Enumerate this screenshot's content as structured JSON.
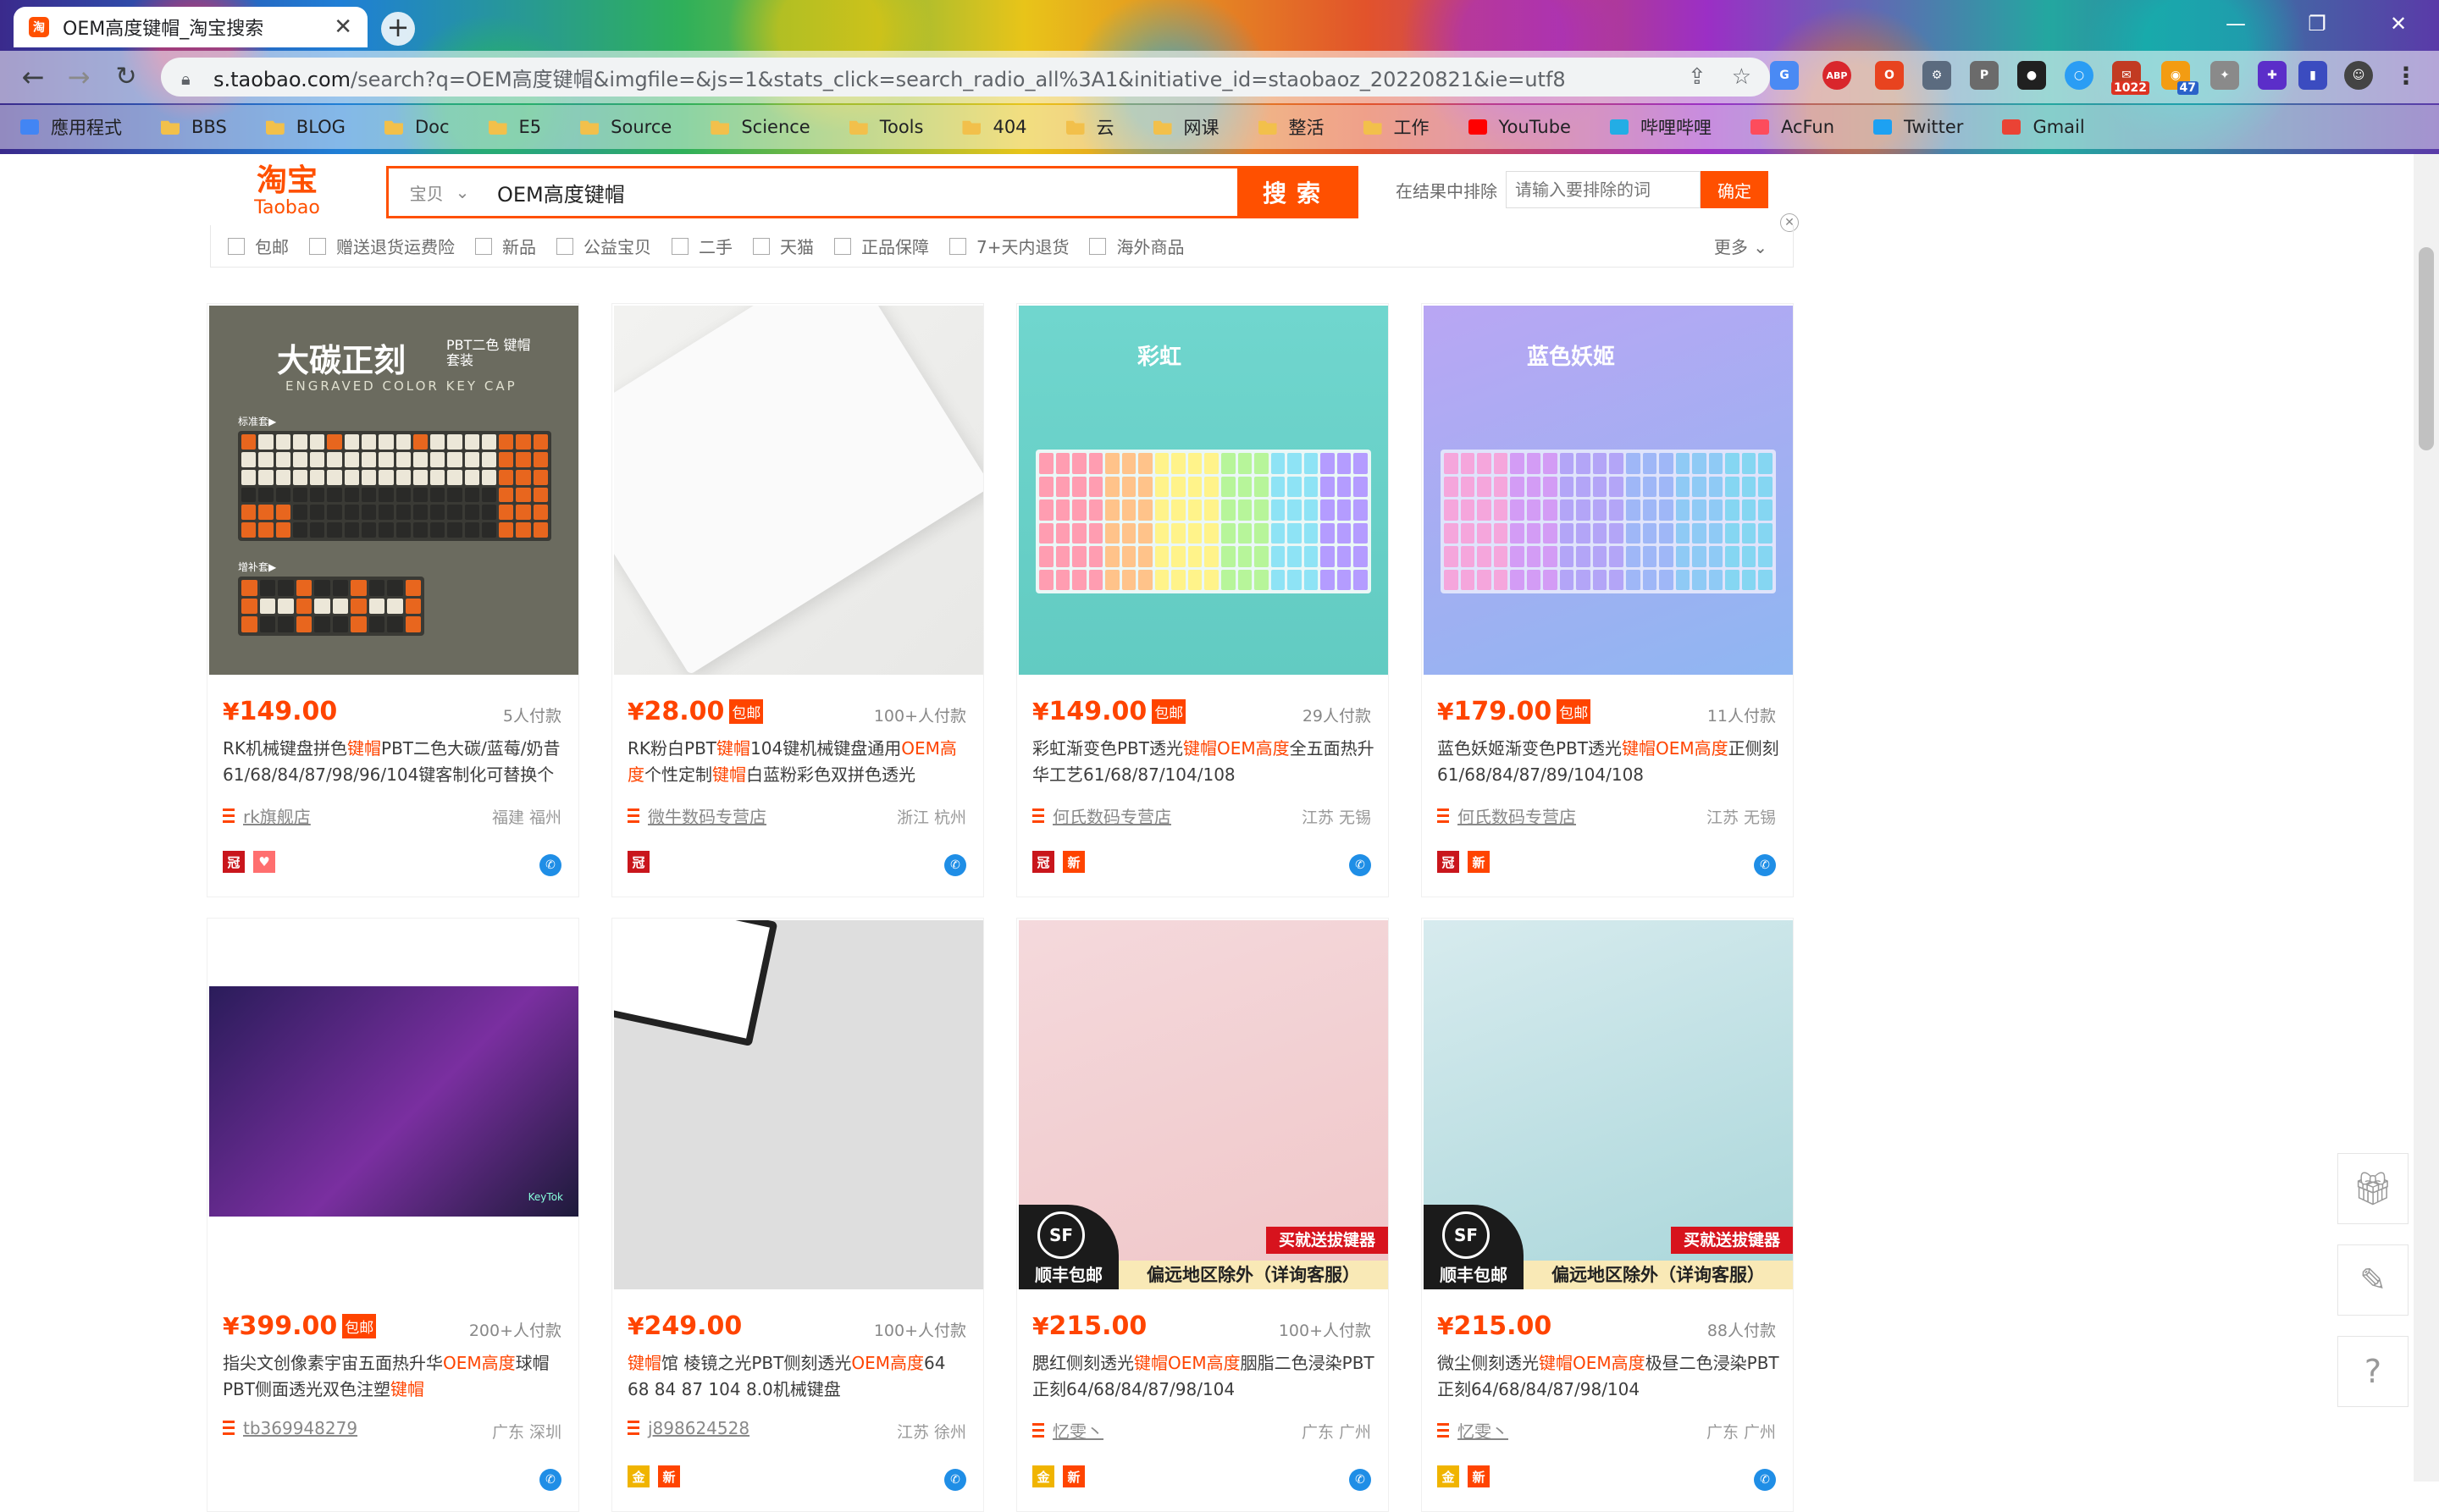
{
  "browser": {
    "tab_title": "OEM高度键帽_淘宝搜索",
    "tab_icon": "taobao-favicon",
    "url_host": "s.taobao.com",
    "url_rest": "/search?q=OEM高度键帽&imgfile=&js=1&stats_click=search_radio_all%3A1&initiative_id=staobaoz_20220821&ie=utf8",
    "extension_badges": {
      "mail": "1022",
      "feed": "47"
    },
    "bookmarks": [
      {
        "label": "應用程式",
        "icon": "apps-grid-icon"
      },
      {
        "label": "BBS",
        "icon": "folder-icon"
      },
      {
        "label": "BLOG",
        "icon": "folder-icon"
      },
      {
        "label": "Doc",
        "icon": "folder-icon"
      },
      {
        "label": "E5",
        "icon": "folder-icon"
      },
      {
        "label": "Source",
        "icon": "folder-icon"
      },
      {
        "label": "Science",
        "icon": "folder-icon"
      },
      {
        "label": "Tools",
        "icon": "folder-icon"
      },
      {
        "label": "404",
        "icon": "folder-icon"
      },
      {
        "label": "云",
        "icon": "folder-icon"
      },
      {
        "label": "网课",
        "icon": "folder-icon"
      },
      {
        "label": "整活",
        "icon": "folder-icon"
      },
      {
        "label": "工作",
        "icon": "folder-icon"
      },
      {
        "label": "YouTube",
        "icon": "youtube-icon"
      },
      {
        "label": "哔哩哔哩",
        "icon": "bilibili-icon"
      },
      {
        "label": "AcFun",
        "icon": "acfun-icon"
      },
      {
        "label": "Twitter",
        "icon": "twitter-icon"
      },
      {
        "label": "Gmail",
        "icon": "gmail-icon"
      }
    ]
  },
  "header": {
    "logo_cn": "淘宝",
    "logo_en": "Taobao",
    "search_category": "宝贝",
    "search_query": "OEM高度键帽",
    "search_button": "搜索",
    "exclude_label": "在结果中排除",
    "exclude_placeholder": "请输入要排除的词",
    "exclude_button": "确定"
  },
  "filters": [
    "包邮",
    "赠送退货运费险",
    "新品",
    "公益宝贝",
    "二手",
    "天猫",
    "正品保障",
    "7+天内退货",
    "海外商品"
  ],
  "filters_more": "更多",
  "products": [
    {
      "price_symbol": "¥",
      "price": "149.00",
      "free_shipping": "",
      "deals": "5人付款",
      "title_parts": [
        [
          "RK机械键盘拼色",
          ""
        ],
        [
          "键帽",
          "hl"
        ],
        [
          "PBT二色大碳/蓝莓/奶昔61/68/84/87/98/96/104键客制化可替换个",
          ""
        ]
      ],
      "shop": "rk旗舰店",
      "location": "福建 福州"
    },
    {
      "price_symbol": "¥",
      "price": "28.00",
      "free_shipping": "包邮",
      "deals": "100+人付款",
      "title_parts": [
        [
          "RK粉白PBT",
          ""
        ],
        [
          "键帽",
          "hl"
        ],
        [
          "104键机械键盘通用",
          ""
        ],
        [
          "OEM高度",
          "hl"
        ],
        [
          "个性定制",
          ""
        ],
        [
          "键帽",
          "hl"
        ],
        [
          "白蓝粉彩色双拼色透光",
          ""
        ]
      ],
      "shop": "微牛数码专营店",
      "location": "浙江 杭州"
    },
    {
      "price_symbol": "¥",
      "price": "149.00",
      "free_shipping": "包邮",
      "deals": "29人付款",
      "title_parts": [
        [
          "彩虹渐变色PBT透光",
          ""
        ],
        [
          "键帽OEM高度",
          "hl"
        ],
        [
          "全五面热升华工艺61/68/87/104/108",
          ""
        ]
      ],
      "shop": "何氏数码专营店",
      "location": "江苏 无锡"
    },
    {
      "price_symbol": "¥",
      "price": "179.00",
      "free_shipping": "包邮",
      "deals": "11人付款",
      "title_parts": [
        [
          "蓝色妖姬渐变色PBT透光",
          ""
        ],
        [
          "键帽OEM高度",
          "hl"
        ],
        [
          "正侧刻61/68/84/87/89/104/108",
          ""
        ]
      ],
      "shop": "何氏数码专营店",
      "location": "江苏 无锡"
    },
    {
      "price_symbol": "¥",
      "price": "399.00",
      "free_shipping": "包邮",
      "deals": "200+人付款",
      "title_parts": [
        [
          "指尖文创像素宇宙五面热升华",
          ""
        ],
        [
          "OEM高度",
          "hl"
        ],
        [
          "球帽PBT侧面透光双色注塑",
          ""
        ],
        [
          "键帽",
          "hl"
        ]
      ],
      "shop": "tb369948279",
      "location": "广东 深圳"
    },
    {
      "price_symbol": "¥",
      "price": "249.00",
      "free_shipping": "",
      "deals": "100+人付款",
      "title_parts": [
        [
          "键帽",
          "hl"
        ],
        [
          "馆 棱镜之光PBT侧刻透光",
          ""
        ],
        [
          "OEM高度",
          "hl"
        ],
        [
          "64 68 84 87 104 8.0机械键盘",
          ""
        ]
      ],
      "shop": "j898624528",
      "location": "江苏 徐州"
    },
    {
      "price_symbol": "¥",
      "price": "215.00",
      "free_shipping": "",
      "deals": "100+人付款",
      "title_parts": [
        [
          "腮红侧刻透光",
          ""
        ],
        [
          "键帽OEM高度",
          "hl"
        ],
        [
          "胭脂二色浸染PBT正刻64/68/84/87/98/104",
          ""
        ]
      ],
      "shop": "忆雯丶",
      "location": "广东 广州",
      "img_banner_right": "买就送拔键器",
      "img_banner_left": "顺丰包邮",
      "img_banner_bottom": "偏远地区除外（详询客服）"
    },
    {
      "price_symbol": "¥",
      "price": "215.00",
      "free_shipping": "",
      "deals": "88人付款",
      "title_parts": [
        [
          "微尘侧刻透光",
          ""
        ],
        [
          "键帽OEM高度",
          "hl"
        ],
        [
          "极昼二色浸染PBT正刻64/68/84/87/98/104",
          ""
        ]
      ],
      "shop": "忆雯丶",
      "location": "广东 广州",
      "img_banner_right": "买就送拔键器",
      "img_banner_left": "顺丰包邮",
      "img_banner_bottom": "偏远地区除外（详询客服）"
    }
  ],
  "image_text": {
    "p1_title": "大碳正刻",
    "p1_sub": "PBT二色 键帽套装",
    "p1_en": "ENGRAVED COLOR KEY CAP",
    "p1_std": "标准套▶",
    "p1_extra": "增补套▶",
    "p3_title": "彩虹",
    "p4_title": "蓝色妖姬",
    "p5_brand": "KeyTok",
    "sf_logo": "SF"
  },
  "side_tools": [
    "gift-icon",
    "edit-icon",
    "help-icon"
  ],
  "colors": {
    "accent": "#ff5000",
    "price": "#ff4400"
  }
}
